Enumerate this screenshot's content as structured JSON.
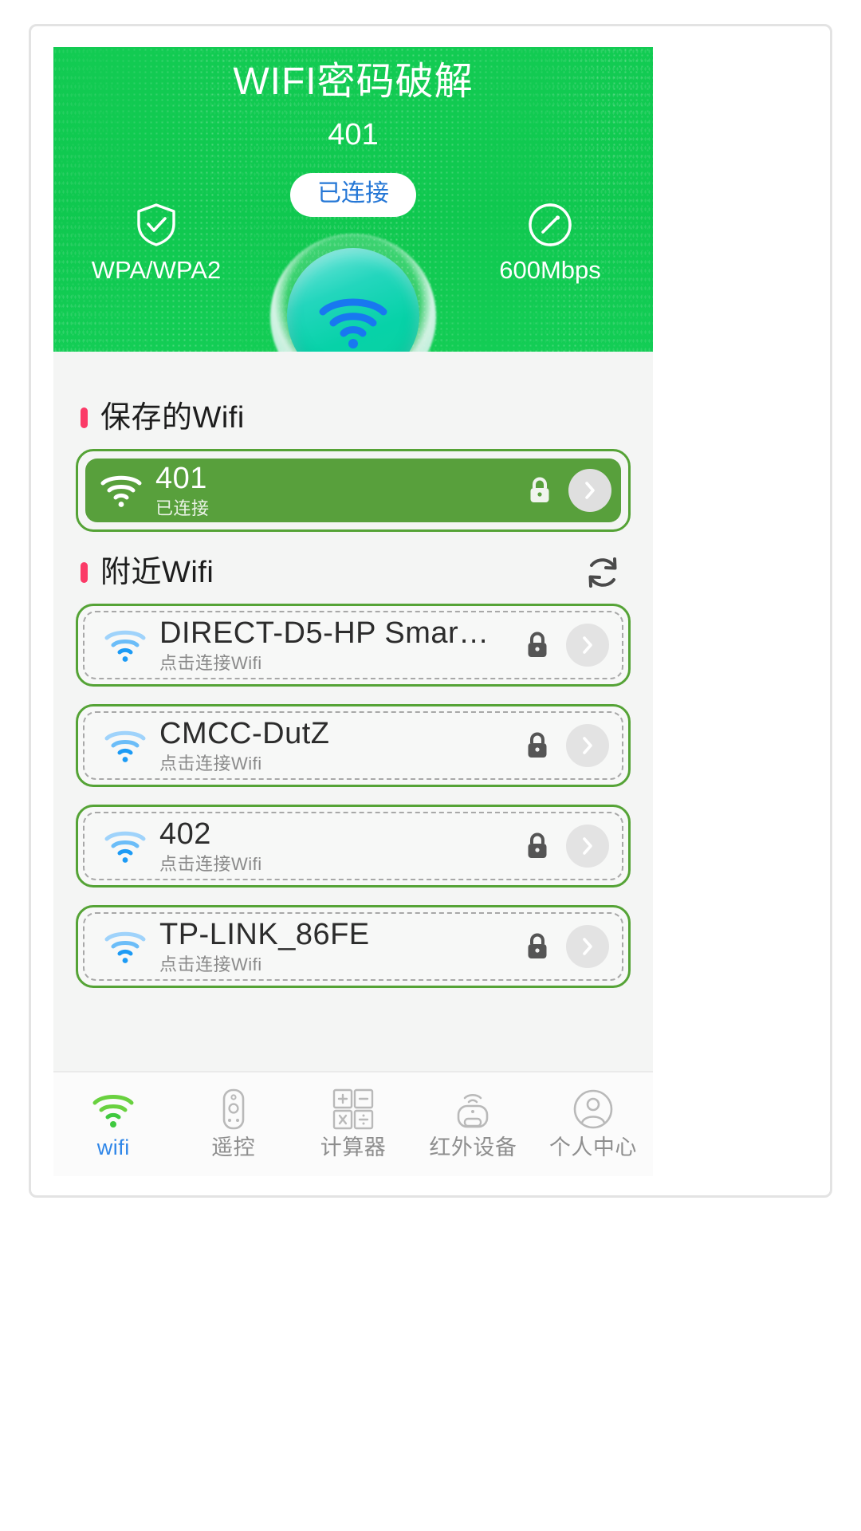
{
  "header": {
    "app_title": "WIFI密码破解",
    "current_ssid": "401",
    "status_badge": "已连接",
    "security": {
      "icon": "shield-check-icon",
      "label": "WPA/WPA2"
    },
    "speed": {
      "icon": "speedometer-icon",
      "label": "600Mbps"
    },
    "center_icon": "wifi-orb-icon",
    "bg_color": "#11ca51",
    "badge_text_color": "#2577d6"
  },
  "saved_section": {
    "title": "保存的Wifi",
    "bullet_color": "#fb3a67",
    "items": [
      {
        "ssid": "401",
        "status": "已连接",
        "wifi_icon": "wifi-full-icon",
        "lock_icon": "lock-icon",
        "chevron_icon": "chevron-right-icon",
        "connected": true
      }
    ]
  },
  "nearby_section": {
    "title": "附近Wifi",
    "bullet_color": "#fb3a67",
    "refresh_icon": "refresh-icon",
    "items": [
      {
        "ssid": "DIRECT-D5-HP Smar…",
        "status": "点击连接Wifi",
        "wifi_icon": "wifi-signal-icon",
        "lock_icon": "lock-icon",
        "chevron_icon": "chevron-right-icon"
      },
      {
        "ssid": "CMCC-DutZ",
        "status": "点击连接Wifi",
        "wifi_icon": "wifi-signal-icon",
        "lock_icon": "lock-icon",
        "chevron_icon": "chevron-right-icon"
      },
      {
        "ssid": "402",
        "status": "点击连接Wifi",
        "wifi_icon": "wifi-signal-icon",
        "lock_icon": "lock-icon",
        "chevron_icon": "chevron-right-icon"
      },
      {
        "ssid": "TP-LINK_86FE",
        "status": "点击连接Wifi",
        "wifi_icon": "wifi-signal-icon",
        "lock_icon": "lock-icon",
        "chevron_icon": "chevron-right-icon"
      }
    ]
  },
  "tabbar": {
    "active_color": "#2f86e8",
    "inactive_color": "#8e8e8e",
    "tabs": [
      {
        "label": "wifi",
        "icon": "wifi-icon",
        "active": true
      },
      {
        "label": "遥控",
        "icon": "remote-icon",
        "active": false
      },
      {
        "label": "计算器",
        "icon": "calculator-icon",
        "active": false
      },
      {
        "label": "红外设备",
        "icon": "infrared-icon",
        "active": false
      },
      {
        "label": "个人中心",
        "icon": "user-icon",
        "active": false
      }
    ]
  }
}
